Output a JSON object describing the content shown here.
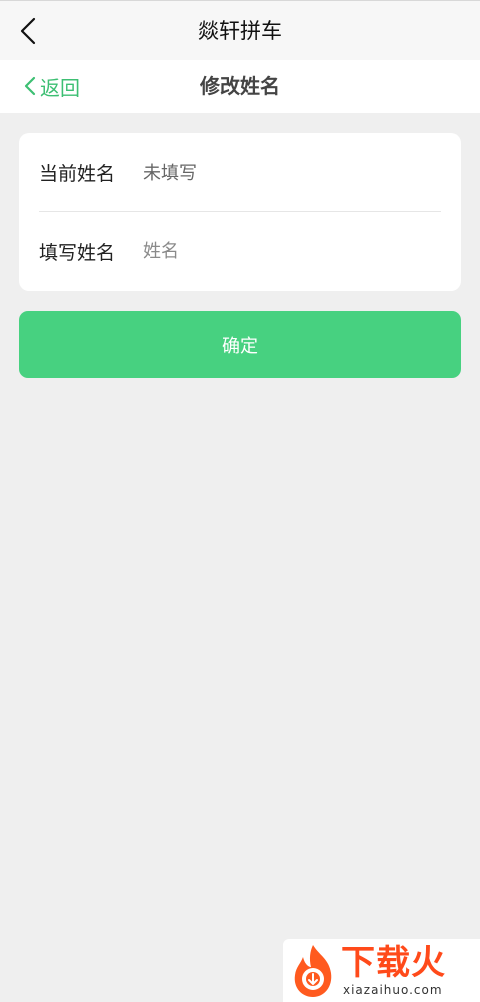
{
  "app_bar": {
    "title": "燚轩拼车",
    "back_icon": "chevron-left-icon"
  },
  "header": {
    "back_label": "返回",
    "back_icon": "chevron-left-icon",
    "title": "修改姓名"
  },
  "form": {
    "current_label": "当前姓名",
    "current_value": "未填写",
    "new_label": "填写姓名",
    "new_placeholder": "姓名",
    "new_value": ""
  },
  "confirm_label": "确定",
  "watermark": {
    "text": "下载火",
    "sub": "xiazaihuo.com"
  },
  "colors": {
    "accent": "#47d180",
    "link": "#3dbf73",
    "watermark": "#ff4a1a",
    "background": "#efefef"
  }
}
